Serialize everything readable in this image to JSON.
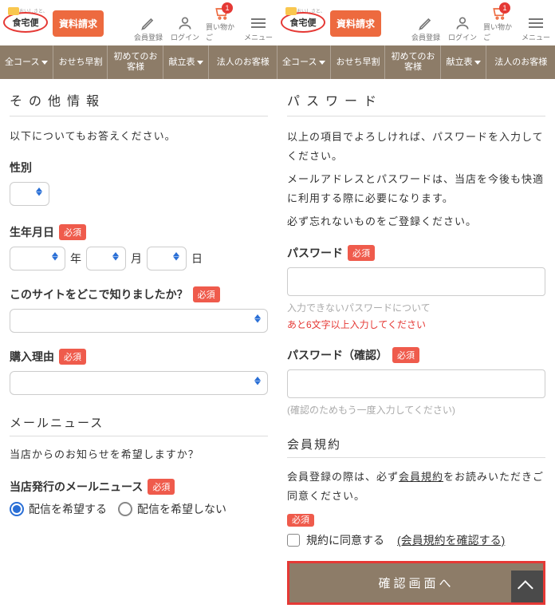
{
  "header": {
    "logo_text": "食宅便",
    "logo_tagline": "おいしさと、",
    "request_btn": "資料請求",
    "nav": {
      "register": "会員登録",
      "login": "ログイン",
      "cart": "買い物かご",
      "cart_badge": "1",
      "menu": "メニュー"
    }
  },
  "tabs": {
    "all_courses": "全コース",
    "osechi": "おせち早割",
    "first_time": "初めてのお客様",
    "menu_table": "献立表",
    "corporate": "法人のお客様"
  },
  "left": {
    "sec_other": "その他情報",
    "other_desc": "以下についてもお答えください。",
    "gender_label": "性別",
    "dob_label": "生年月日",
    "year_unit": "年",
    "month_unit": "月",
    "day_unit": "日",
    "referrer_label": "このサイトをどこで知りましたか？",
    "reason_label": "購入理由",
    "sec_mail": "メールニュース",
    "mail_q": "当店からのお知らせを希望しますか？",
    "mail_news_label": "当店発行のメールニュース",
    "opt_in": "配信を希望する",
    "opt_out": "配信を希望しない",
    "required": "必須"
  },
  "right": {
    "sec_pw": "パスワード",
    "pw_desc1": "以上の項目でよろしければ、パスワードを入力してください。",
    "pw_desc2": "メールアドレスとパスワードは、当店を今後も快適に利用する際に必要になります。",
    "pw_desc3": "必ず忘れないものをご登録ください。",
    "pw_label": "パスワード",
    "pw_hint": "入力できないパスワードについて",
    "pw_err": "あと6文字以上入力してください",
    "pw_confirm_label": "パスワード（確認）",
    "pw_confirm_hint": "(確認のためもう一度入力してください)",
    "sec_terms": "会員規約",
    "terms_desc_a": "会員登録の際は、必ず",
    "terms_link": "会員規約",
    "terms_desc_b": "をお読みいただきご同意ください。",
    "agree_label": "規約に同意する",
    "terms_check_link": "(会員規約を確認する)",
    "confirm_btn": "確認画面へ",
    "required": "必須"
  }
}
